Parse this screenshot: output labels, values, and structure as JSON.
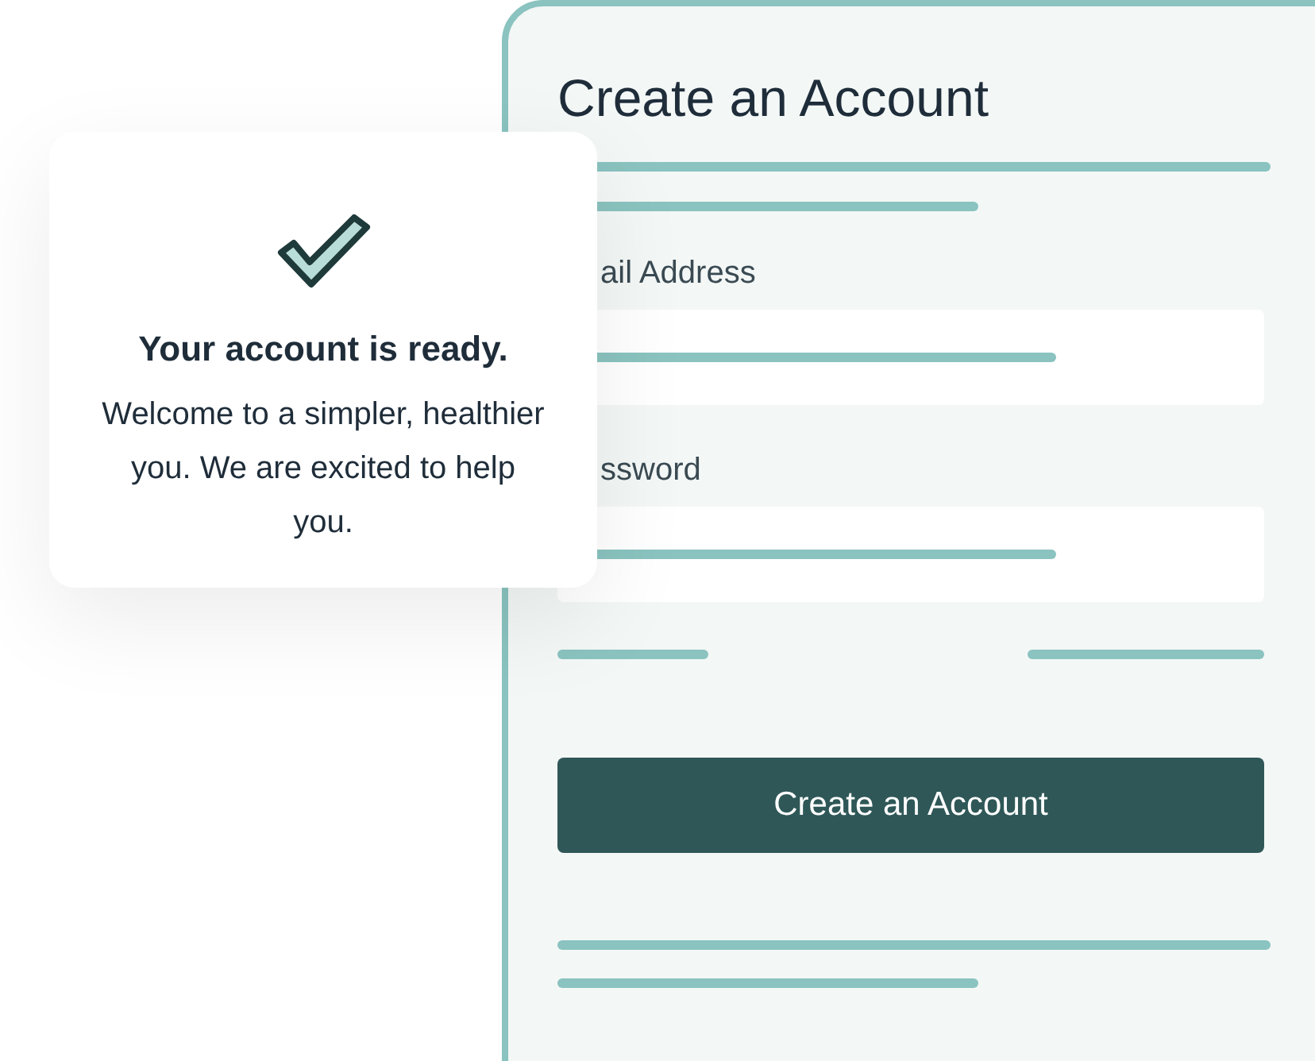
{
  "form": {
    "title": "Create an Account",
    "fields": [
      {
        "label": "ail Address"
      },
      {
        "label": "ssword"
      }
    ],
    "button": "Create an Account"
  },
  "notice": {
    "title": "Your account is ready.",
    "message": "Welcome to a simpler, healthier you. We are excited to help you."
  }
}
